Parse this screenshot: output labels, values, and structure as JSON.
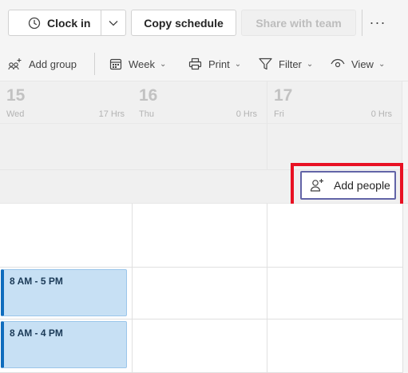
{
  "topbar": {
    "clock_in_label": "Clock in",
    "copy_schedule_label": "Copy schedule",
    "share_label": "Share with team",
    "more_label": "···"
  },
  "toolbar": {
    "add_group_label": "Add group",
    "week_label": "Week",
    "print_label": "Print",
    "filter_label": "Filter",
    "view_label": "View"
  },
  "days": [
    {
      "num": "15",
      "name": "Wed",
      "hours": "17 Hrs"
    },
    {
      "num": "16",
      "name": "Thu",
      "hours": "0 Hrs"
    },
    {
      "num": "17",
      "name": "Fri",
      "hours": "0 Hrs"
    }
  ],
  "group": {
    "add_people_label": "Add people"
  },
  "shifts": [
    {
      "label": "8 AM - 5 PM"
    },
    {
      "label": "8 AM - 4 PM"
    }
  ],
  "colors": {
    "shift_fill": "#c7e0f4",
    "shift_accent": "#0f6cbd",
    "highlight": "#e81123",
    "button_accent": "#6264a7"
  }
}
